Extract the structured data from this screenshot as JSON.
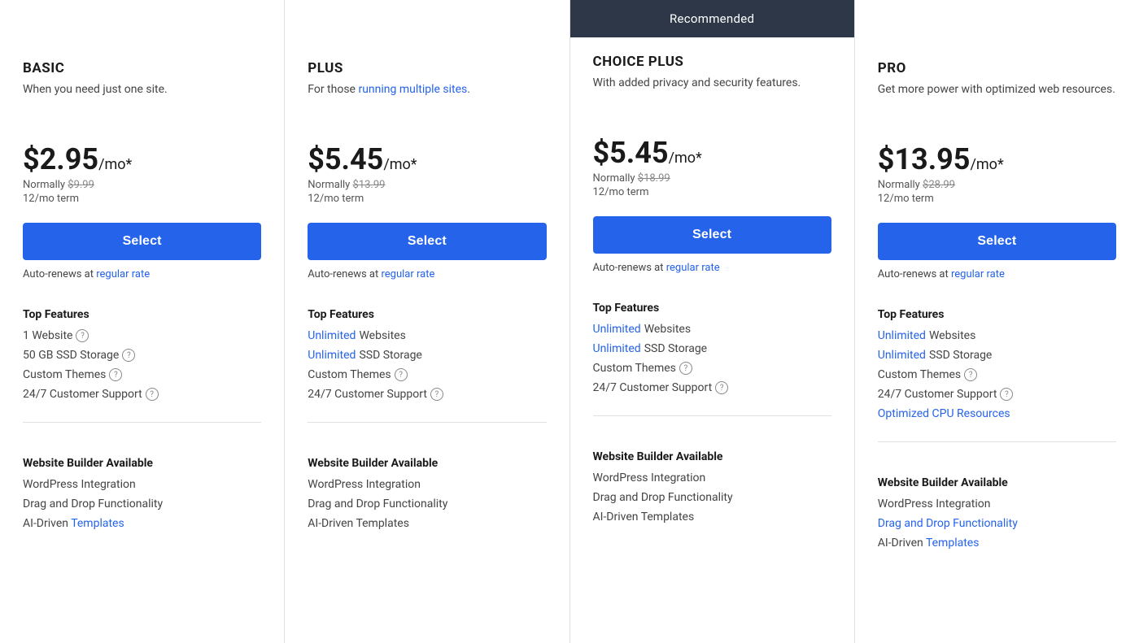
{
  "recommended_label": "Recommended",
  "plans": [
    {
      "id": "basic",
      "name": "BASIC",
      "desc_parts": [
        "When you need just one site."
      ],
      "desc_has_link": false,
      "price": "$2.95",
      "per_mo": "/mo*",
      "normal_price": "$9.99",
      "term": "12/mo term",
      "select_label": "Select",
      "auto_renew_text": "Auto-renews at ",
      "auto_renew_link": "regular rate",
      "top_features_label": "Top Features",
      "features": [
        {
          "text": "1 Website",
          "link": false,
          "info": true
        },
        {
          "text": "50 GB SSD Storage",
          "link": false,
          "info": true
        },
        {
          "text": "Custom Themes",
          "link": false,
          "info": true
        },
        {
          "text": "24/7 Customer Support",
          "link": false,
          "info": true
        }
      ],
      "builder_label": "Website Builder Available",
      "builder_items": [
        {
          "text": "WordPress Integration",
          "link": false
        },
        {
          "text": "Drag and Drop Functionality",
          "link": false
        },
        {
          "text": "AI-Driven Templates",
          "link": false
        }
      ],
      "recommended": false
    },
    {
      "id": "plus",
      "name": "PLUS",
      "desc_parts": [
        "For those ",
        "running multiple sites",
        "."
      ],
      "desc_has_link": true,
      "price": "$5.45",
      "per_mo": "/mo*",
      "normal_price": "$13.99",
      "term": "12/mo term",
      "select_label": "Select",
      "auto_renew_text": "Auto-renews at ",
      "auto_renew_link": "regular rate",
      "top_features_label": "Top Features",
      "features": [
        {
          "text_link": "Unlimited",
          "text_rest": " Websites",
          "link": true,
          "info": false
        },
        {
          "text_link": "Unlimited",
          "text_rest": " SSD Storage",
          "link": true,
          "info": false
        },
        {
          "text": "Custom Themes",
          "link": false,
          "info": true
        },
        {
          "text": "24/7 Customer Support",
          "link": false,
          "info": true
        }
      ],
      "builder_label": "Website Builder Available",
      "builder_items": [
        {
          "text": "WordPress Integration",
          "link": false
        },
        {
          "text": "Drag and Drop Functionality",
          "link": false
        },
        {
          "text": "AI-Driven Templates",
          "link": false
        }
      ],
      "recommended": false
    },
    {
      "id": "choice-plus",
      "name": "CHOICE PLUS",
      "desc_parts": [
        "With added privacy and security features."
      ],
      "desc_has_link": false,
      "price": "$5.45",
      "per_mo": "/mo*",
      "normal_price": "$18.99",
      "term": "12/mo term",
      "select_label": "Select",
      "auto_renew_text": "Auto-renews at ",
      "auto_renew_link": "regular rate",
      "top_features_label": "Top Features",
      "features": [
        {
          "text_link": "Unlimited",
          "text_rest": " Websites",
          "link": true,
          "info": false
        },
        {
          "text_link": "Unlimited",
          "text_rest": " SSD Storage",
          "link": true,
          "info": false
        },
        {
          "text": "Custom Themes",
          "link": false,
          "info": true
        },
        {
          "text": "24/7 Customer Support",
          "link": false,
          "info": true
        }
      ],
      "builder_label": "Website Builder Available",
      "builder_items": [
        {
          "text": "WordPress Integration",
          "link": false
        },
        {
          "text": "Drag and Drop Functionality",
          "link": false
        },
        {
          "text": "AI-Driven Templates",
          "link": false
        }
      ],
      "recommended": true
    },
    {
      "id": "pro",
      "name": "PRO",
      "desc_parts": [
        "Get more power with optimized web resources."
      ],
      "desc_has_link": false,
      "price": "$13.95",
      "per_mo": "/mo*",
      "normal_price": "$28.99",
      "term": "12/mo term",
      "select_label": "Select",
      "auto_renew_text": "Auto-renews at ",
      "auto_renew_link": "regular rate",
      "top_features_label": "Top Features",
      "features": [
        {
          "text_link": "Unlimited",
          "text_rest": " Websites",
          "link": true,
          "info": false
        },
        {
          "text_link": "Unlimited",
          "text_rest": " SSD Storage",
          "link": true,
          "info": false
        },
        {
          "text": "Custom Themes",
          "link": false,
          "info": true
        },
        {
          "text": "24/7 Customer Support",
          "link": false,
          "info": true
        },
        {
          "text_link": "Optimized CPU Resources",
          "text_rest": "",
          "link": true,
          "info": false
        }
      ],
      "builder_label": "Website Builder Available",
      "builder_items": [
        {
          "text": "WordPress Integration",
          "link": false
        },
        {
          "text": "Drag and Drop Functionality",
          "link": false
        },
        {
          "text": "AI-Driven Templates",
          "link": false
        }
      ],
      "recommended": false
    }
  ]
}
